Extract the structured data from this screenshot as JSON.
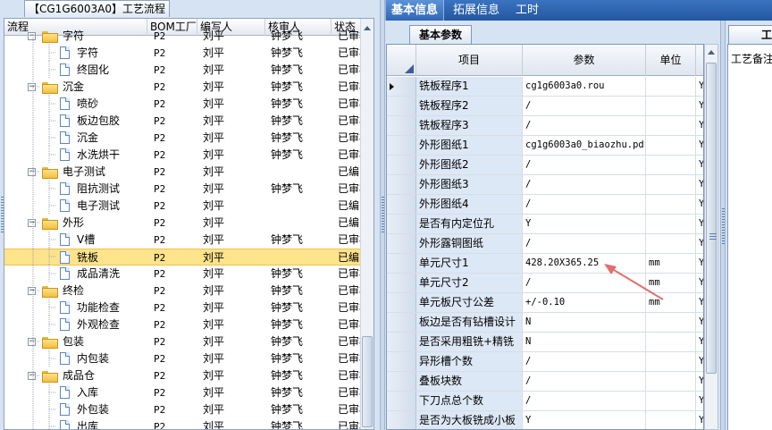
{
  "left": {
    "tab_title": "【CG1G6003A0】工艺流程",
    "columns": [
      "流程",
      "BOM工厂",
      "编写人",
      "核审人",
      "状态"
    ],
    "rows": [
      {
        "indent": 2,
        "icon": "folder",
        "expander": "-",
        "name": "字符",
        "bom": "P2",
        "author": "刘平",
        "reviewer": "钟梦飞",
        "status": "已审核",
        "clipped": true
      },
      {
        "indent": 3,
        "icon": "doc",
        "name": "字符",
        "bom": "P2",
        "author": "刘平",
        "reviewer": "钟梦飞",
        "status": "已审核"
      },
      {
        "indent": 3,
        "icon": "doc",
        "name": "终固化",
        "bom": "P2",
        "author": "刘平",
        "reviewer": "钟梦飞",
        "status": "已审核"
      },
      {
        "indent": 2,
        "icon": "folder",
        "expander": "-",
        "name": "沉金",
        "bom": "P2",
        "author": "刘平",
        "reviewer": "钟梦飞",
        "status": "已审核"
      },
      {
        "indent": 3,
        "icon": "doc",
        "name": "喷砂",
        "bom": "P2",
        "author": "刘平",
        "reviewer": "钟梦飞",
        "status": "已审核"
      },
      {
        "indent": 3,
        "icon": "doc",
        "name": "板边包胶",
        "bom": "P2",
        "author": "刘平",
        "reviewer": "钟梦飞",
        "status": "已审核"
      },
      {
        "indent": 3,
        "icon": "doc",
        "name": "沉金",
        "bom": "P2",
        "author": "刘平",
        "reviewer": "钟梦飞",
        "status": "已审核"
      },
      {
        "indent": 3,
        "icon": "doc",
        "name": "水洗烘干",
        "bom": "P2",
        "author": "刘平",
        "reviewer": "钟梦飞",
        "status": "已审核"
      },
      {
        "indent": 2,
        "icon": "folder",
        "expander": "-",
        "name": "电子测试",
        "bom": "P2",
        "author": "刘平",
        "reviewer": "",
        "status": "已编写"
      },
      {
        "indent": 3,
        "icon": "doc",
        "name": "阻抗测试",
        "bom": "P2",
        "author": "刘平",
        "reviewer": "钟梦飞",
        "status": "已审核"
      },
      {
        "indent": 3,
        "icon": "doc",
        "name": "电子测试",
        "bom": "P2",
        "author": "刘平",
        "reviewer": "",
        "status": "已编写"
      },
      {
        "indent": 2,
        "icon": "folder",
        "expander": "-",
        "name": "外形",
        "bom": "P2",
        "author": "刘平",
        "reviewer": "",
        "status": "已编写"
      },
      {
        "indent": 3,
        "icon": "doc",
        "name": "V槽",
        "bom": "P2",
        "author": "刘平",
        "reviewer": "钟梦飞",
        "status": "已审核"
      },
      {
        "indent": 3,
        "icon": "doc",
        "name": "铣板",
        "bom": "P2",
        "author": "刘平",
        "reviewer": "",
        "status": "已编写",
        "selected": true
      },
      {
        "indent": 3,
        "icon": "doc",
        "name": "成品清洗",
        "bom": "P2",
        "author": "刘平",
        "reviewer": "钟梦飞",
        "status": "已审核"
      },
      {
        "indent": 2,
        "icon": "folder",
        "expander": "-",
        "name": "终检",
        "bom": "P2",
        "author": "刘平",
        "reviewer": "钟梦飞",
        "status": "已审核"
      },
      {
        "indent": 3,
        "icon": "doc",
        "name": "功能检查",
        "bom": "P2",
        "author": "刘平",
        "reviewer": "钟梦飞",
        "status": "已审核"
      },
      {
        "indent": 3,
        "icon": "doc",
        "name": "外观检查",
        "bom": "P2",
        "author": "刘平",
        "reviewer": "钟梦飞",
        "status": "已审核"
      },
      {
        "indent": 2,
        "icon": "folder",
        "expander": "-",
        "name": "包装",
        "bom": "P2",
        "author": "刘平",
        "reviewer": "钟梦飞",
        "status": "已审核"
      },
      {
        "indent": 3,
        "icon": "doc",
        "name": "内包装",
        "bom": "P2",
        "author": "刘平",
        "reviewer": "钟梦飞",
        "status": "已审核"
      },
      {
        "indent": 2,
        "icon": "folder",
        "expander": "-",
        "name": "成品仓",
        "bom": "P2",
        "author": "刘平",
        "reviewer": "钟梦飞",
        "status": "已审核"
      },
      {
        "indent": 3,
        "icon": "doc",
        "name": "入库",
        "bom": "P2",
        "author": "刘平",
        "reviewer": "钟梦飞",
        "status": "已审核"
      },
      {
        "indent": 3,
        "icon": "doc",
        "name": "外包装",
        "bom": "P2",
        "author": "刘平",
        "reviewer": "钟梦飞",
        "status": "已审核"
      },
      {
        "indent": 3,
        "icon": "doc",
        "name": "出库",
        "bom": "P2",
        "author": "刘平",
        "reviewer": "钟梦飞",
        "status": "已审核"
      }
    ]
  },
  "middle": {
    "tabs": [
      "基本信息",
      "拓展信息",
      "工时"
    ],
    "active_tab": 0,
    "sub_tab": "基本参数",
    "columns": [
      "项目",
      "参数",
      "单位"
    ],
    "rows": [
      {
        "item": "铣板程序1",
        "param": "cg1g6003a0.rou",
        "unit": "",
        "flag": "Y",
        "current": true
      },
      {
        "item": "铣板程序2",
        "param": "/",
        "unit": "",
        "flag": "Y"
      },
      {
        "item": "铣板程序3",
        "param": "/",
        "unit": "",
        "flag": "Y"
      },
      {
        "item": "外形图纸1",
        "param": "cg1g6003a0_biaozhu.pdf",
        "unit": "",
        "flag": "Y"
      },
      {
        "item": "外形图纸2",
        "param": "/",
        "unit": "",
        "flag": "Y"
      },
      {
        "item": "外形图纸3",
        "param": "/",
        "unit": "",
        "flag": "Y"
      },
      {
        "item": "外形图纸4",
        "param": "/",
        "unit": "",
        "flag": "Y"
      },
      {
        "item": "是否有内定位孔",
        "param": "Y",
        "unit": "",
        "flag": "Y"
      },
      {
        "item": "外形露铜图纸",
        "param": "/",
        "unit": "",
        "flag": "Y"
      },
      {
        "item": "单元尺寸1",
        "param": "428.20X365.25",
        "unit": "mm",
        "flag": "Y"
      },
      {
        "item": "单元尺寸2",
        "param": "/",
        "unit": "mm",
        "flag": "Y"
      },
      {
        "item": "单元板尺寸公差",
        "param": "+/-0.10",
        "unit": "mm",
        "flag": "Y"
      },
      {
        "item": "板边是否有钻槽设计",
        "param": "N",
        "unit": "",
        "flag": "Y"
      },
      {
        "item": "是否采用粗铣+精铣",
        "param": "N",
        "unit": "",
        "flag": "Y"
      },
      {
        "item": "异形槽个数",
        "param": "/",
        "unit": "",
        "flag": "Y"
      },
      {
        "item": "叠板块数",
        "param": "/",
        "unit": "",
        "flag": "Y"
      },
      {
        "item": "下刀点总个数",
        "param": "/",
        "unit": "",
        "flag": "Y"
      },
      {
        "item": "是否为大板铣成小板",
        "param": "Y",
        "unit": "",
        "flag": "Y"
      }
    ]
  },
  "right": {
    "tab_label": "工",
    "label": "工艺备注"
  },
  "colors": {
    "selected_row": "#fde38a",
    "annotation_arrow": "#e07070",
    "header_blue": "#2f66b3"
  }
}
